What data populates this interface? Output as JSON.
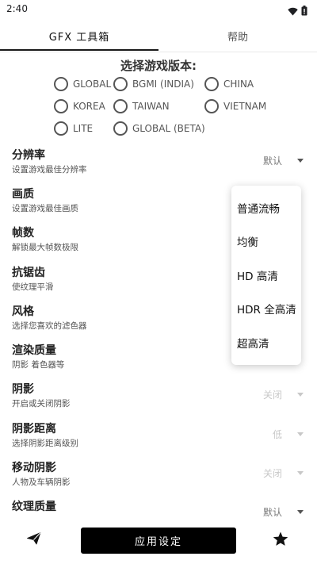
{
  "status_bar": {
    "time": "2:40",
    "icons": [
      "wifi-icon",
      "battery-icon"
    ]
  },
  "tabs": [
    {
      "label": "GFX 工具箱",
      "active": true
    },
    {
      "label": "帮助",
      "active": false
    }
  ],
  "version_selector": {
    "title": "选择游戏版本:",
    "options": [
      "GLOBAL",
      "BGMI (INDIA)",
      "CHINA",
      "KOREA",
      "TAIWAN",
      "VIETNAM",
      "LITE",
      "GLOBAL (BETA)"
    ]
  },
  "settings": [
    {
      "title": "分辨率",
      "desc": "设置游戏最佳分辨率",
      "value": "默认",
      "enabled": true
    },
    {
      "title": "画质",
      "desc": "设置游戏最佳画质",
      "value": "",
      "enabled": true
    },
    {
      "title": "帧数",
      "desc": "解锁最大帧数极限",
      "value": "",
      "enabled": true
    },
    {
      "title": "抗锯齿",
      "desc": "使纹理平滑",
      "value": "",
      "enabled": true
    },
    {
      "title": "风格",
      "desc": "选择您喜欢的滤色器",
      "value": "",
      "enabled": true
    },
    {
      "title": "渲染质量",
      "desc": "阴影 着色器等",
      "value": "",
      "enabled": true
    },
    {
      "title": "阴影",
      "desc": "开启或关闭阴影",
      "value": "关闭",
      "enabled": false
    },
    {
      "title": "阴影距离",
      "desc": "选择阴影距离级别",
      "value": "低",
      "enabled": false
    },
    {
      "title": "移动阴影",
      "desc": "人物及车辆阴影",
      "value": "关闭",
      "enabled": false
    },
    {
      "title": "纹理质量",
      "desc": "",
      "value": "默认",
      "enabled": true
    }
  ],
  "dropdown": {
    "items": [
      "普通流畅",
      "均衡",
      "HD 高清",
      "HDR 全高清",
      "超高清"
    ]
  },
  "bottom_bar": {
    "apply_label": "应用设定",
    "left_icon": "send-icon",
    "right_icon": "star-icon"
  },
  "colors": {
    "primary": "#000000",
    "text": "#222222",
    "secondary_text": "#555555",
    "disabled": "#c8c8c8"
  }
}
